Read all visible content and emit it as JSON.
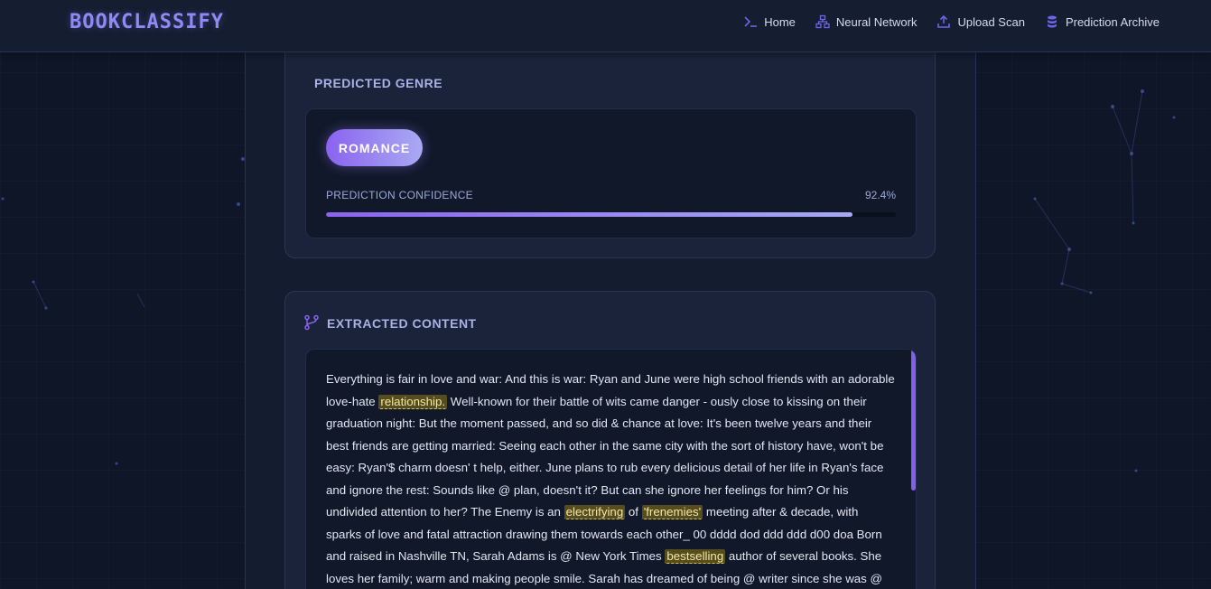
{
  "app": {
    "brand": "BOOKCLASSIFY"
  },
  "nav": {
    "items": [
      {
        "label": "Home",
        "icon": "terminal-icon"
      },
      {
        "label": "Neural Network",
        "icon": "network-icon"
      },
      {
        "label": "Upload Scan",
        "icon": "upload-icon"
      },
      {
        "label": "Prediction Archive",
        "icon": "database-icon"
      }
    ]
  },
  "prediction": {
    "title": "PREDICTED GENRE",
    "genre": "ROMANCE",
    "confidence_label": "PREDICTION CONFIDENCE",
    "confidence_text": "92.4%",
    "confidence": 0.924
  },
  "extracted": {
    "title": "EXTRACTED CONTENT",
    "segments": [
      {
        "t": "Everything is fair in love and war: And this is war: Ryan and June were high school friends with an adorable love-hate "
      },
      {
        "t": "relationship.",
        "hl": true
      },
      {
        "t": " Well-known for their battle of wits came danger - ously close to kissing on their graduation night: But the moment passed, and so did & chance at love: It's been twelve years and their best friends are getting married: Seeing each other in the same city with the sort of history have, won't be easy: Ryan'$ charm doesn' t help, either. June plans to rub every delicious detail of her life in Ryan's face and ignore the rest: Sounds like @ plan, doesn't it? But can she ignore her feelings for him? Or his undivided attention to her? The Enemy is an "
      },
      {
        "t": "electrifying",
        "hl": true
      },
      {
        "t": " of "
      },
      {
        "t": "'frenemies'",
        "hl": true
      },
      {
        "t": " meeting after & decade, with sparks of love and fatal attraction drawing them towards each other_ 00 dddd dod ddd ddd d00 doa Born and raised in Nashville TN, Sarah Adams is @ New York Times "
      },
      {
        "t": "bestselling",
        "hl": true
      },
      {
        "t": " author of several books. She loves her family; warm and making people smile. Sarah has dreamed of being @ writer since she was @"
      }
    ]
  },
  "colors": {
    "accent": "#8a63f0",
    "highlight_bg": "#564d1e",
    "background": "#0f1627"
  }
}
